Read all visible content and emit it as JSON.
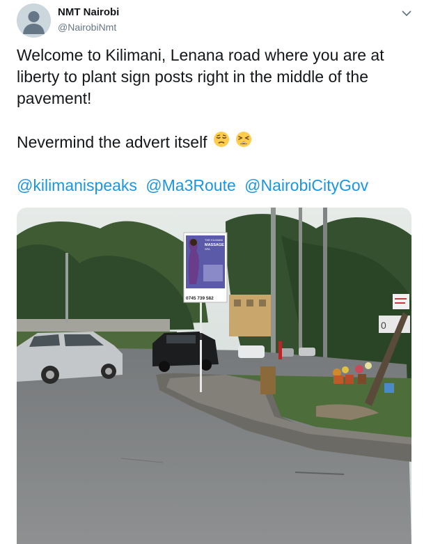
{
  "author": {
    "display_name": "NMT Nairobi",
    "handle": "@NairobiNmt"
  },
  "tweet": {
    "line1": "Welcome to Kilimani, Lenana road where you are at liberty to plant sign posts right in the middle of the pavement!",
    "line2": "Nevermind the advert itself",
    "emojis": [
      "relieved-face-emoji",
      "weary-face-emoji"
    ],
    "mentions": [
      "@kilimanispeaks",
      "@Ma3Route",
      "@NairobiCityGov"
    ]
  },
  "photo": {
    "billboard": {
      "title_line1": "THE KILIMANI",
      "title_line2": "MASSAGE",
      "title_line3": "SPA",
      "phone": "0745 739 582"
    },
    "sign_text": "0"
  },
  "colors": {
    "link": "#1b95e0",
    "secondary_text": "#657786",
    "primary_text": "#14171a"
  }
}
